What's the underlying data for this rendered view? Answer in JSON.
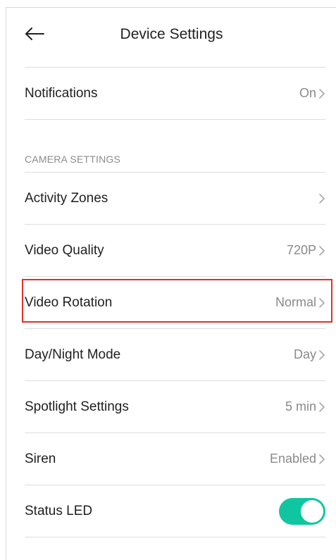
{
  "header": {
    "title": "Device Settings"
  },
  "notifications": {
    "label": "Notifications",
    "value": "On"
  },
  "camera_section": {
    "heading": "CAMERA SETTINGS"
  },
  "settings": {
    "activity_zones": {
      "label": "Activity Zones",
      "value": ""
    },
    "video_quality": {
      "label": "Video Quality",
      "value": "720P"
    },
    "video_rotation": {
      "label": "Video Rotation",
      "value": "Normal"
    },
    "day_night": {
      "label": "Day/Night Mode",
      "value": "Day"
    },
    "spotlight": {
      "label": "Spotlight Settings",
      "value": "5 min"
    },
    "siren": {
      "label": "Siren",
      "value": "Enabled"
    },
    "status_led": {
      "label": "Status LED",
      "enabled": true
    }
  },
  "colors": {
    "toggle_on": "#10c6a1",
    "highlight": "#e0302a",
    "secondary_text": "#8a8a8a"
  },
  "icons": {
    "back": "arrow-left-icon",
    "chevron": "chevron-right-icon"
  }
}
